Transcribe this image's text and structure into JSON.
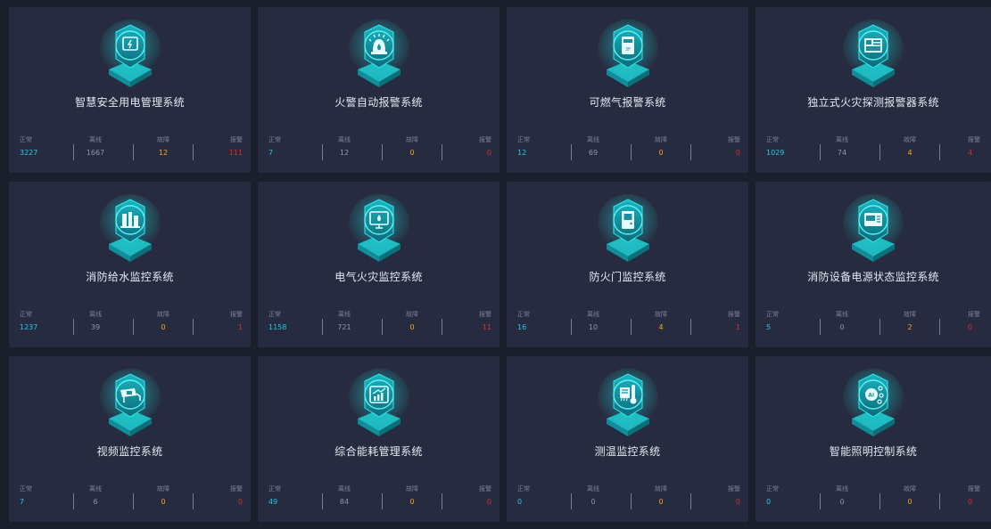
{
  "colors": {
    "background": "#1a1f2c",
    "card": "#262b3f",
    "accent": "#1ed3d6",
    "normal": "#25c8e6",
    "offline": "#8d96b5",
    "fault": "#f5a623",
    "alarm": "#d32f2f"
  },
  "stat_labels": {
    "normal": "正常",
    "offline": "离线",
    "fault": "故障",
    "alarm": "报警"
  },
  "systems": [
    {
      "name": "智慧安全用电管理系统",
      "icon": "power-panel-icon",
      "normal": "3227",
      "offline": "1667",
      "fault": "12",
      "alarm": "111"
    },
    {
      "name": "火警自动报警系统",
      "icon": "alarm-siren-icon",
      "normal": "7",
      "offline": "12",
      "fault": "0",
      "alarm": "0"
    },
    {
      "name": "可燃气报警系统",
      "icon": "gas-detector-icon",
      "normal": "12",
      "offline": "69",
      "fault": "0",
      "alarm": "0"
    },
    {
      "name": "独立式火灾探测报警器系统",
      "icon": "detector-panel-icon",
      "normal": "1029",
      "offline": "74",
      "fault": "4",
      "alarm": "4"
    },
    {
      "name": "消防给水监控系统",
      "icon": "water-pump-icon",
      "normal": "1237",
      "offline": "39",
      "fault": "0",
      "alarm": "1"
    },
    {
      "name": "电气火灾监控系统",
      "icon": "electric-fire-monitor-icon",
      "normal": "1158",
      "offline": "721",
      "fault": "0",
      "alarm": "11"
    },
    {
      "name": "防火门监控系统",
      "icon": "fire-door-icon",
      "normal": "16",
      "offline": "10",
      "fault": "4",
      "alarm": "1"
    },
    {
      "name": "消防设备电源状态监控系统",
      "icon": "power-supply-monitor-icon",
      "normal": "5",
      "offline": "0",
      "fault": "2",
      "alarm": "0"
    },
    {
      "name": "视频监控系统",
      "icon": "cctv-camera-icon",
      "normal": "7",
      "offline": "6",
      "fault": "0",
      "alarm": "0"
    },
    {
      "name": "综合能耗管理系统",
      "icon": "energy-chart-icon",
      "normal": "49",
      "offline": "84",
      "fault": "0",
      "alarm": "0"
    },
    {
      "name": "测温监控系统",
      "icon": "thermometer-icon",
      "normal": "0",
      "offline": "0",
      "fault": "0",
      "alarm": "0"
    },
    {
      "name": "智能照明控制系统",
      "icon": "ai-lighting-icon",
      "normal": "0",
      "offline": "0",
      "fault": "0",
      "alarm": "0"
    }
  ]
}
